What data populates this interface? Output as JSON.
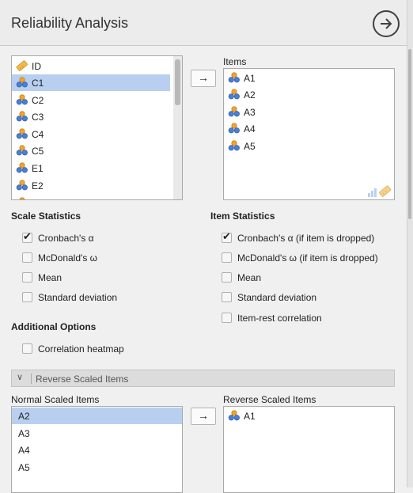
{
  "header": {
    "title": "Reliability Analysis",
    "run_icon": "arrow-circle-right-icon"
  },
  "source_list": {
    "items": [
      {
        "label": "ID",
        "icon": "ruler-icon",
        "selected": false
      },
      {
        "label": "C1",
        "icon": "ordinal-variable-icon",
        "selected": true
      },
      {
        "label": "C2",
        "icon": "ordinal-variable-icon",
        "selected": false
      },
      {
        "label": "C3",
        "icon": "ordinal-variable-icon",
        "selected": false
      },
      {
        "label": "C4",
        "icon": "ordinal-variable-icon",
        "selected": false
      },
      {
        "label": "C5",
        "icon": "ordinal-variable-icon",
        "selected": false
      },
      {
        "label": "E1",
        "icon": "ordinal-variable-icon",
        "selected": false
      },
      {
        "label": "E2",
        "icon": "ordinal-variable-icon",
        "selected": false
      }
    ]
  },
  "items_box": {
    "label": "Items",
    "items": [
      "A1",
      "A2",
      "A3",
      "A4",
      "A5"
    ],
    "accepts_icons": [
      "ordinal-bars-icon",
      "ruler-icon"
    ]
  },
  "move_button": {
    "symbol": "→"
  },
  "scale_statistics": {
    "heading": "Scale Statistics",
    "options": [
      {
        "label": "Cronbach's α",
        "checked": true
      },
      {
        "label": "McDonald's ω",
        "checked": false
      },
      {
        "label": "Mean",
        "checked": false
      },
      {
        "label": "Standard deviation",
        "checked": false
      }
    ]
  },
  "item_statistics": {
    "heading": "Item Statistics",
    "options": [
      {
        "label": "Cronbach's α (if item is dropped)",
        "checked": true
      },
      {
        "label": "McDonald's ω (if item is dropped)",
        "checked": false
      },
      {
        "label": "Mean",
        "checked": false
      },
      {
        "label": "Standard deviation",
        "checked": false
      },
      {
        "label": "Item-rest correlation",
        "checked": false
      }
    ]
  },
  "additional_options": {
    "heading": "Additional Options",
    "options": [
      {
        "label": "Correlation heatmap",
        "checked": false
      }
    ]
  },
  "reverse_section": {
    "title": "Reverse Scaled Items",
    "chevron": "∨",
    "normal_label": "Normal Scaled Items",
    "normal_items": [
      {
        "label": "A2",
        "selected": true
      },
      {
        "label": "A3",
        "selected": false
      },
      {
        "label": "A4",
        "selected": false
      },
      {
        "label": "A5",
        "selected": false
      }
    ],
    "reverse_label": "Reverse Scaled Items",
    "reverse_items": [
      "A1"
    ]
  },
  "colors": {
    "selection": "#b8cff0",
    "variable_icon_blue": "#4a7fd4",
    "variable_icon_orange": "#f2a52a"
  }
}
